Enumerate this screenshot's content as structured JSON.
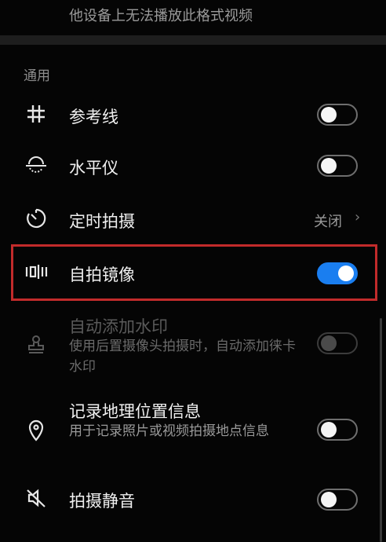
{
  "prev_item": {
    "clipped_text": "",
    "description": "他设备上无法播放此格式视频"
  },
  "section_title": "通用",
  "items": [
    {
      "label": "参考线",
      "icon": "grid-icon",
      "toggle": false
    },
    {
      "label": "水平仪",
      "icon": "level-icon",
      "toggle": false
    },
    {
      "label": "定时拍摄",
      "icon": "timer-icon",
      "value": "关闭",
      "chevron": "›"
    },
    {
      "label": "自拍镜像",
      "icon": "mirror-icon",
      "toggle": true
    },
    {
      "label": "自动添加水印",
      "sub": "使用后置摄像头拍摄时，自动添加徕卡水印",
      "icon": "stamp-icon",
      "toggle": false,
      "disabled": true
    },
    {
      "label": "记录地理位置信息",
      "sub": "用于记录照片或视频拍摄地点信息",
      "icon": "location-pin-icon",
      "toggle": false
    },
    {
      "label": "拍摄静音",
      "icon": "mute-icon",
      "toggle": false
    }
  ],
  "colors": {
    "accent": "#1a7ef0",
    "highlight_border": "#c22b2b"
  }
}
